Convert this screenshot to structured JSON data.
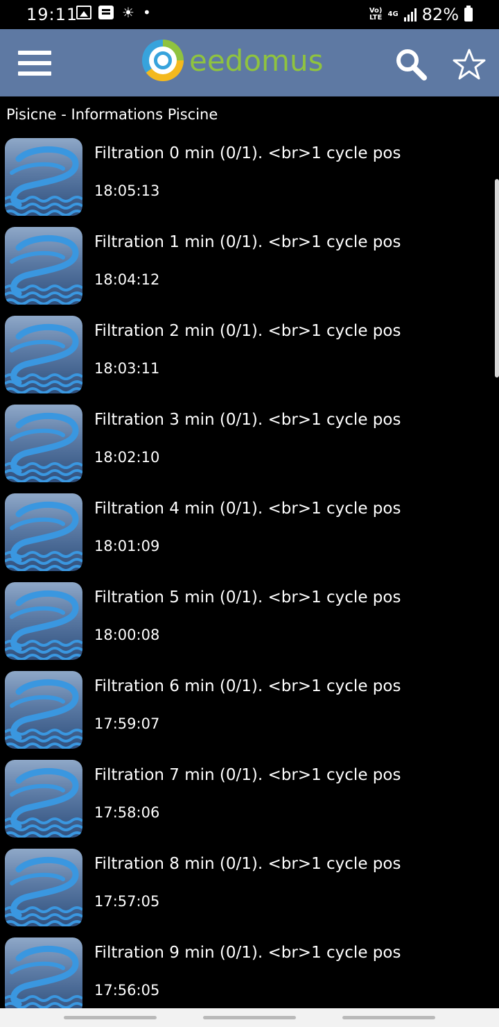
{
  "status_bar": {
    "time": "19:11",
    "dot": "•",
    "network_top": "Vo)",
    "network_bottom": "LTE",
    "net_type": "4G",
    "battery": "82%",
    "icons": [
      "image-icon",
      "message-icon",
      "weather-icon",
      "signal-icon",
      "battery-icon"
    ]
  },
  "app_bar": {
    "logo_text": "eedomus",
    "icons": [
      "menu-icon",
      "search-icon",
      "star-icon"
    ],
    "colors": {
      "background": "#5e79a3",
      "logo_green": "#8fc33f",
      "logo_blue": "#37a3dc",
      "logo_yellow": "#f4b91e"
    }
  },
  "page": {
    "title": "Pisicne - Informations Piscine"
  },
  "list": {
    "item_icon": "pool-icon",
    "items": [
      {
        "title": "Filtration  0 min (0/1). <br>1 cycle pos",
        "time": "18:05:13"
      },
      {
        "title": "Filtration  1 min (0/1). <br>1 cycle pos",
        "time": "18:04:12"
      },
      {
        "title": "Filtration  2 min (0/1). <br>1 cycle pos",
        "time": "18:03:11"
      },
      {
        "title": "Filtration  3 min (0/1). <br>1 cycle pos",
        "time": "18:02:10"
      },
      {
        "title": "Filtration  4 min (0/1). <br>1 cycle pos",
        "time": "18:01:09"
      },
      {
        "title": "Filtration  5 min (0/1). <br>1 cycle pos",
        "time": "18:00:08"
      },
      {
        "title": "Filtration  6 min (0/1). <br>1 cycle pos",
        "time": "17:59:07"
      },
      {
        "title": "Filtration  7 min (0/1). <br>1 cycle pos",
        "time": "17:58:06"
      },
      {
        "title": "Filtration  8 min (0/1). <br>1 cycle pos",
        "time": "17:57:05"
      },
      {
        "title": "Filtration  9 min (0/1). <br>1 cycle pos",
        "time": "17:56:05"
      }
    ]
  }
}
